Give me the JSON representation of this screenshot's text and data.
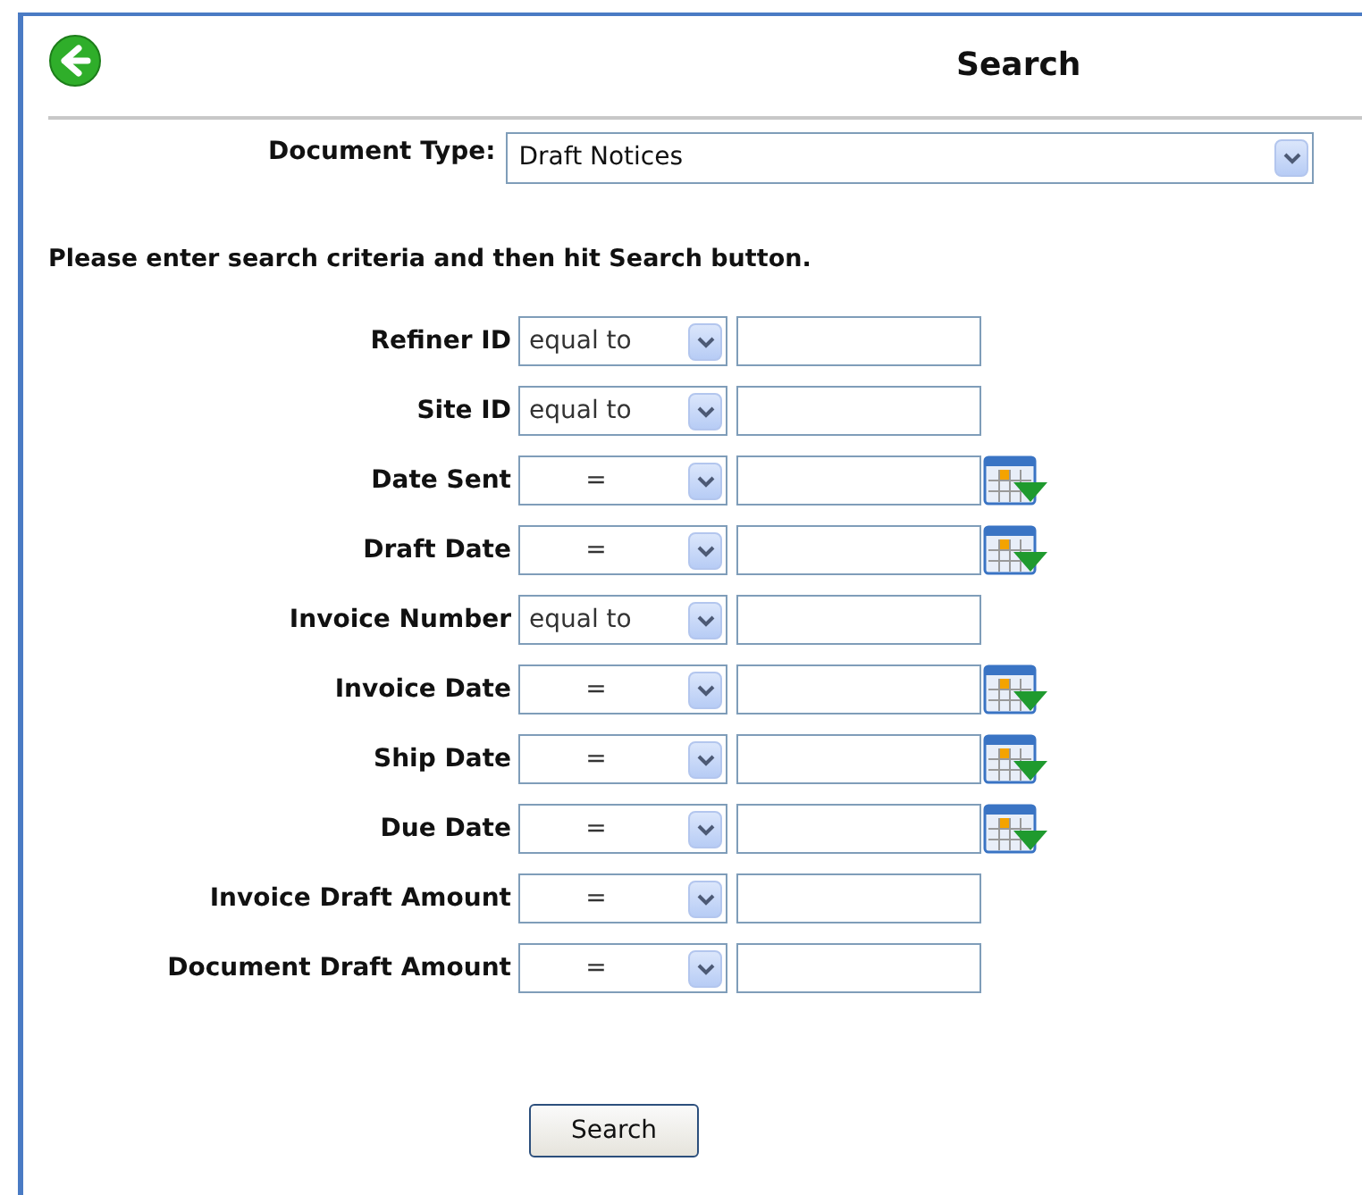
{
  "header": {
    "title": "Search"
  },
  "document_type": {
    "label": "Document Type:",
    "value": "Draft Notices"
  },
  "instructions": "Please enter search criteria and then hit Search button.",
  "criteria": [
    {
      "label": "Refiner ID",
      "operator": "equal to",
      "kind": "text"
    },
    {
      "label": "Site ID",
      "operator": "equal to",
      "kind": "text"
    },
    {
      "label": "Date Sent",
      "operator": "=",
      "kind": "date"
    },
    {
      "label": "Draft Date",
      "operator": "=",
      "kind": "date"
    },
    {
      "label": "Invoice Number",
      "operator": "equal to",
      "kind": "text"
    },
    {
      "label": "Invoice Date",
      "operator": "=",
      "kind": "date"
    },
    {
      "label": "Ship Date",
      "operator": "=",
      "kind": "date"
    },
    {
      "label": "Due Date",
      "operator": "=",
      "kind": "date"
    },
    {
      "label": "Invoice Draft Amount",
      "operator": "=",
      "kind": "text"
    },
    {
      "label": "Document Draft Amount",
      "operator": "=",
      "kind": "text"
    }
  ],
  "search_button": "Search"
}
